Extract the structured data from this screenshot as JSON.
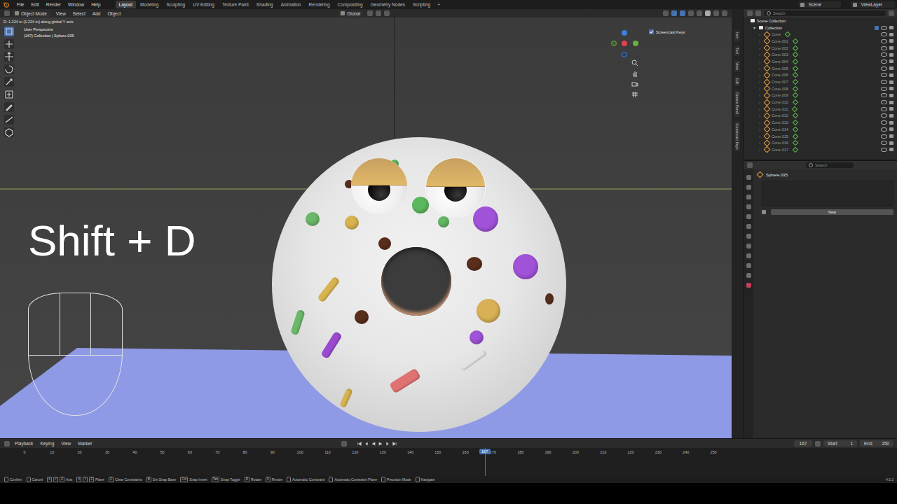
{
  "menu": [
    "File",
    "Edit",
    "Render",
    "Window",
    "Help"
  ],
  "workspaces": [
    {
      "label": "Layout",
      "selected": true
    },
    {
      "label": "Modeling",
      "selected": false
    },
    {
      "label": "Sculpting",
      "selected": false
    },
    {
      "label": "UV Editing",
      "selected": false
    },
    {
      "label": "Texture Paint",
      "selected": false
    },
    {
      "label": "Shading",
      "selected": false
    },
    {
      "label": "Animation",
      "selected": false
    },
    {
      "label": "Rendering",
      "selected": false
    },
    {
      "label": "Compositing",
      "selected": false
    },
    {
      "label": "Geometry Nodes",
      "selected": false
    },
    {
      "label": "Scripting",
      "selected": false
    }
  ],
  "add_workspace": "+",
  "scene": "Scene",
  "view_layer": "ViewLayer",
  "viewport": {
    "mode": "Object Mode",
    "menus": [
      "View",
      "Select",
      "Add",
      "Object"
    ],
    "orientation": "Global",
    "operator_status": "D: 1.224 m (1.224 m) along global Y axis",
    "view_name": "User Perspective",
    "context": "(167) Collection | Sphere.035",
    "keystroke": "Shift + D",
    "overlay_toggle": {
      "label": "Screencast Keys",
      "checked": true
    }
  },
  "tools": [
    {
      "selected": true
    },
    {
      "selected": false
    },
    {
      "selected": false
    },
    {
      "selected": false
    },
    {
      "selected": false
    },
    {
      "selected": false
    },
    {
      "selected": false
    },
    {
      "selected": false
    },
    {
      "selected": false
    }
  ],
  "sidebar_tabs": [
    "Item",
    "Tool",
    "View",
    "Edit",
    "Grease Pencil",
    "Screencast Keys"
  ],
  "sprinkles": [
    {
      "kind": "dot",
      "color": "#6cb86a"
    },
    {
      "kind": "dot",
      "color": "#d8b450"
    },
    {
      "kind": "dot",
      "color": "#5cb85e"
    },
    {
      "kind": "dot",
      "color": "#62b865"
    },
    {
      "kind": "dot",
      "color": "#a052d8"
    },
    {
      "kind": "dot",
      "color": "#5a2e1c"
    },
    {
      "kind": "dot",
      "color": "#5a2e1c"
    },
    {
      "kind": "dot",
      "color": "#a052d8"
    },
    {
      "kind": "dot",
      "color": "#d8b055"
    },
    {
      "kind": "dot",
      "color": "#5a2e1c"
    },
    {
      "kind": "dot",
      "color": "#5a2e1c"
    },
    {
      "kind": "dot",
      "color": "#a052d8"
    },
    {
      "kind": "dot",
      "color": "#5cb85e"
    },
    {
      "kind": "dot",
      "color": "#5a2e1c"
    },
    {
      "kind": "rod",
      "color": "#d8b450"
    },
    {
      "kind": "rod",
      "color": "#6cb86a"
    },
    {
      "kind": "rod",
      "color": "#9a4ad0"
    },
    {
      "kind": "rod",
      "color": "#e07272"
    },
    {
      "kind": "rod",
      "color": "#e4e4e4"
    },
    {
      "kind": "rod",
      "color": "#d8b450"
    }
  ],
  "outliner": {
    "search_placeholder": "Search",
    "root": "Scene Collection",
    "collection": "Collection",
    "objects": [
      "Cone",
      "Cone.001",
      "Cone.002",
      "Cone.003",
      "Cone.004",
      "Cone.005",
      "Cone.006",
      "Cone.007",
      "Cone.008",
      "Cone.009",
      "Cone.010",
      "Cone.011",
      "Cone.012",
      "Cone.013",
      "Cone.014",
      "Cone.015",
      "Cone.016",
      "Cone.017"
    ]
  },
  "properties": {
    "search_placeholder": "Search",
    "object": "Sphere.035",
    "new_button": "New"
  },
  "timeline": {
    "menus": [
      "Playback",
      "Keying",
      "View",
      "Marker"
    ],
    "current_frame": "167",
    "start_label": "Start",
    "start": "1",
    "end_label": "End",
    "end": "250",
    "ticks": [
      "0",
      "10",
      "20",
      "30",
      "40",
      "50",
      "60",
      "70",
      "80",
      "90",
      "100",
      "110",
      "120",
      "130",
      "140",
      "150",
      "160",
      "170",
      "180",
      "190",
      "200",
      "210",
      "220",
      "230",
      "240",
      "250"
    ]
  },
  "status_bar": {
    "items": [
      {
        "keys": [],
        "label": "Confirm"
      },
      {
        "keys": [],
        "label": "Cancel"
      },
      {
        "keys": [
          "X",
          "Y",
          "Z"
        ],
        "label": "Axis"
      },
      {
        "keys": [
          "X",
          "Y",
          "Z"
        ],
        "label": "Plane"
      },
      {
        "keys": [
          "C"
        ],
        "label": "Clear Constraints"
      },
      {
        "keys": [
          "B"
        ],
        "label": "Set Snap Base"
      },
      {
        "keys": [
          "Ctrl"
        ],
        "label": "Snap Invert"
      },
      {
        "keys": [
          "Tab"
        ],
        "label": "Snap Toggle"
      },
      {
        "keys": [
          "R"
        ],
        "label": "Rotate"
      },
      {
        "keys": [
          "S"
        ],
        "label": "Resize"
      },
      {
        "keys": [],
        "label": "Automatic Constraint"
      },
      {
        "keys": [],
        "label": "Automatic Constraint Plane"
      },
      {
        "keys": [],
        "label": "Precision Mode"
      },
      {
        "keys": [],
        "label": "Navigate"
      }
    ],
    "version": "4.5.2"
  }
}
